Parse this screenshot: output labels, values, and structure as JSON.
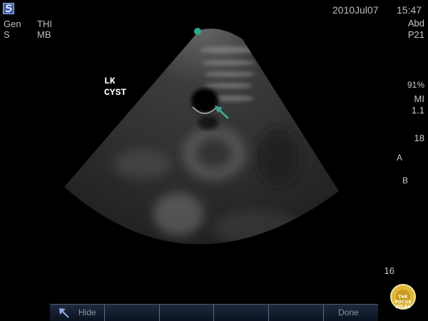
{
  "header": {
    "left_col1": [
      "Gen",
      "S"
    ],
    "left_col2": [
      "THI",
      "MB"
    ],
    "date": "2010Jul07",
    "time": "15:47"
  },
  "annotation": {
    "line1": "LK",
    "line2": "CYST"
  },
  "right_panel": {
    "preset": "Abd",
    "probe": "P21",
    "battery_percent_label": "91%",
    "mi_label": "MI",
    "mi_value": "1.1",
    "gain_value": "18",
    "a_label": "A",
    "b_label": "B",
    "depth_value": "16"
  },
  "bottom_bar": {
    "hide_label": "Hide",
    "done_label": "Done"
  },
  "badge": {
    "line1": "THE",
    "line2": "POCUS",
    "line3": "ATLAS"
  },
  "colors": {
    "marker": "#2fa58e",
    "arrow": "#3aa58f",
    "badge": "#e0b73a"
  },
  "icons": [
    "logo-icon",
    "orientation-marker-icon",
    "arrow-pointer-icon",
    "battery-icon",
    "save-icon",
    "gain-icon",
    "print-icon",
    "film-icon",
    "usb-icon",
    "hide-arrow-icon"
  ]
}
